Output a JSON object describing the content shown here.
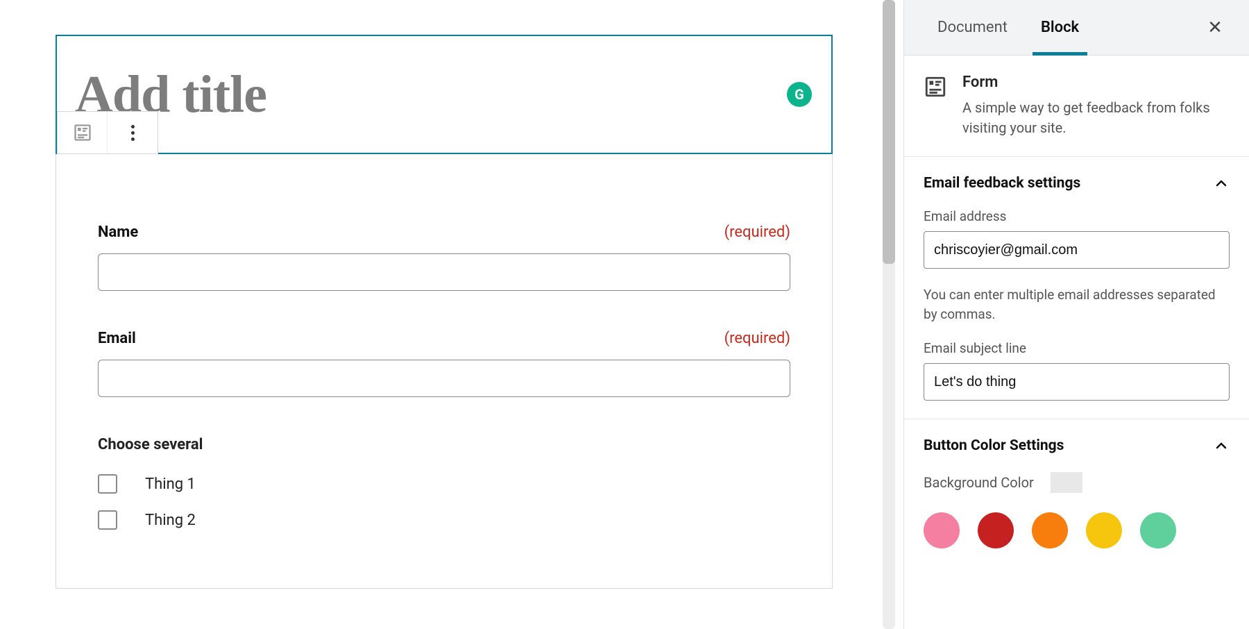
{
  "editor": {
    "title_placeholder": "Add title",
    "grammarly_glyph": "G"
  },
  "form": {
    "fields": [
      {
        "label": "Name",
        "required_text": "(required)"
      },
      {
        "label": "Email",
        "required_text": "(required)"
      }
    ],
    "checkbox_group": {
      "label": "Choose several",
      "options": [
        "Thing 1",
        "Thing 2"
      ]
    }
  },
  "sidebar": {
    "tabs": {
      "document": "Document",
      "block": "Block"
    },
    "block_info": {
      "title": "Form",
      "description": "A simple way to get feedback from folks visiting your site."
    },
    "email_section": {
      "title": "Email feedback settings",
      "address_label": "Email address",
      "address_value": "chriscoyier@gmail.com",
      "help": "You can enter multiple email addresses separated by commas.",
      "subject_label": "Email subject line",
      "subject_value": "Let's do thing"
    },
    "button_color_section": {
      "title": "Button Color Settings",
      "bg_label": "Background Color",
      "swatches": [
        "#f47fa0",
        "#c62121",
        "#f77d0d",
        "#f6c50e",
        "#5fcf9c"
      ]
    }
  }
}
